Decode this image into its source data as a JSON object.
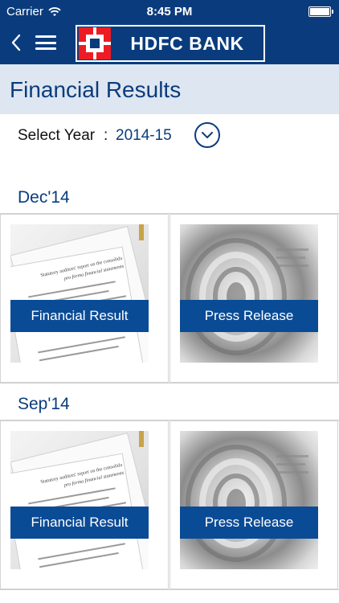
{
  "status_bar": {
    "carrier": "Carrier",
    "time": "8:45 PM"
  },
  "header": {
    "logo_text": "HDFC BANK"
  },
  "page": {
    "title": "Financial Results"
  },
  "year_selector": {
    "label": "Select Year",
    "separator": ":",
    "value": "2014-15"
  },
  "sections": [
    {
      "title": "Dec'14",
      "cards": [
        {
          "label": "Financial Result",
          "thumbnail": "document-thumbnail",
          "thumb_text_1": "Statutory auditors' report on the consolida",
          "thumb_text_2": "pro forma financial statements"
        },
        {
          "label": "Press Release",
          "thumbnail": "newspaper-thumbnail"
        }
      ]
    },
    {
      "title": "Sep'14",
      "cards": [
        {
          "label": "Financial Result",
          "thumbnail": "document-thumbnail",
          "thumb_text_1": "Statutory auditors' report on the consolida",
          "thumb_text_2": "pro forma financial statements"
        },
        {
          "label": "Press Release",
          "thumbnail": "newspaper-thumbnail"
        }
      ]
    }
  ],
  "colors": {
    "brand_blue": "#0a3c7d",
    "logo_red": "#ed1c24",
    "title_band": "#dde6f1",
    "card_label_bg": "#0a4b96"
  },
  "icons": {
    "back": "chevron-left-icon",
    "menu": "hamburger-icon",
    "dropdown": "chevron-down-circle-icon",
    "wifi": "wifi-icon",
    "battery": "battery-icon"
  }
}
